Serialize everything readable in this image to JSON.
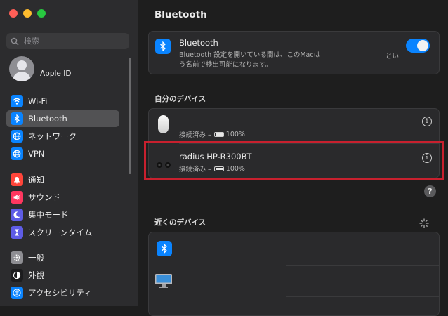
{
  "window": {
    "title": "Bluetooth"
  },
  "sidebar": {
    "search_placeholder": "検索",
    "account_label": "Apple ID",
    "items": [
      {
        "label": "Wi-Fi",
        "icon": "wifi-icon",
        "color": "#0a84ff"
      },
      {
        "label": "Bluetooth",
        "icon": "bluetooth-icon",
        "color": "#0a84ff",
        "active": true
      },
      {
        "label": "ネットワーク",
        "icon": "globe-icon",
        "color": "#0a84ff"
      },
      {
        "label": "VPN",
        "icon": "vpn-globe-icon",
        "color": "#0a84ff"
      },
      {
        "label": "通知",
        "icon": "bell-icon",
        "color": "#ff453a"
      },
      {
        "label": "サウンド",
        "icon": "speaker-icon",
        "color": "#ff375f"
      },
      {
        "label": "集中モード",
        "icon": "moon-icon",
        "color": "#5e5ce6"
      },
      {
        "label": "スクリーンタイム",
        "icon": "hourglass-icon",
        "color": "#5e5ce6"
      },
      {
        "label": "一般",
        "icon": "gear-icon",
        "color": "#8e8e93"
      },
      {
        "label": "外観",
        "icon": "appearance-icon",
        "color": "#1c1c1e"
      },
      {
        "label": "アクセシビリティ",
        "icon": "accessibility-icon",
        "color": "#0a84ff"
      }
    ]
  },
  "bluetooth_card": {
    "title": "Bluetooth",
    "description_line1": "Bluetooth 設定を開いている間は、このMacは",
    "description_line2": "う名前で検出可能になります。",
    "description_suffix": "とい",
    "enabled": true
  },
  "my_devices": {
    "title": "自分のデバイス",
    "devices": [
      {
        "name": "",
        "status": "接続済み –",
        "battery": "100%",
        "icon": "mouse-icon"
      },
      {
        "name": "radius HP-R300BT",
        "status": "接続済み –",
        "battery": "100%",
        "icon": "earbuds-icon"
      }
    ]
  },
  "nearby_devices": {
    "title": "近くのデバイス"
  },
  "help_label": "?",
  "info_label": "i"
}
